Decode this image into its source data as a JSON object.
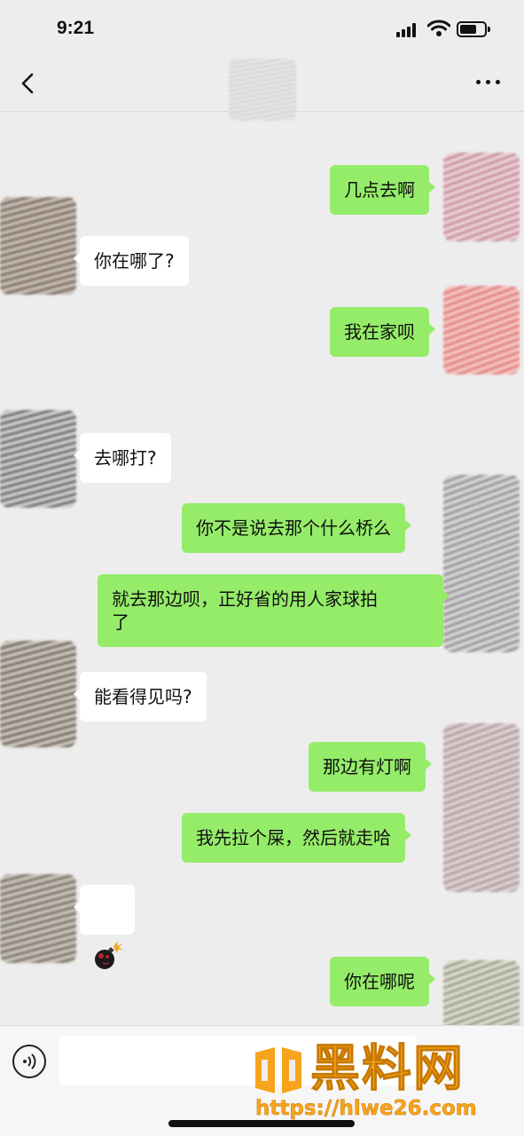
{
  "status_bar": {
    "time": "9:21"
  },
  "watermark": {
    "brand": "黑料网",
    "url": "https://hlwe26.com"
  },
  "messages": [
    {
      "side": "me",
      "text": "几点去啊"
    },
    {
      "side": "them",
      "text": "你在哪了?"
    },
    {
      "side": "me",
      "text": "我在家呗"
    },
    {
      "side": "them",
      "text": "去哪打?"
    },
    {
      "side": "me",
      "text": "你不是说去那个什么桥么"
    },
    {
      "side": "me",
      "text": "就去那边呗，正好省的用人家球拍\n了"
    },
    {
      "side": "them",
      "text": "能看得见吗?"
    },
    {
      "side": "me",
      "text": "那边有灯啊"
    },
    {
      "side": "me",
      "text": "我先拉个屎，然后就走哈"
    },
    {
      "side": "them",
      "emoji": "bomb-icon"
    },
    {
      "side": "me",
      "text": "你在哪呢"
    }
  ],
  "colors": {
    "bg": "#ededed",
    "me_bubble": "#95ec69",
    "them_bubble": "#ffffff",
    "watermark": "#f7a41c"
  }
}
